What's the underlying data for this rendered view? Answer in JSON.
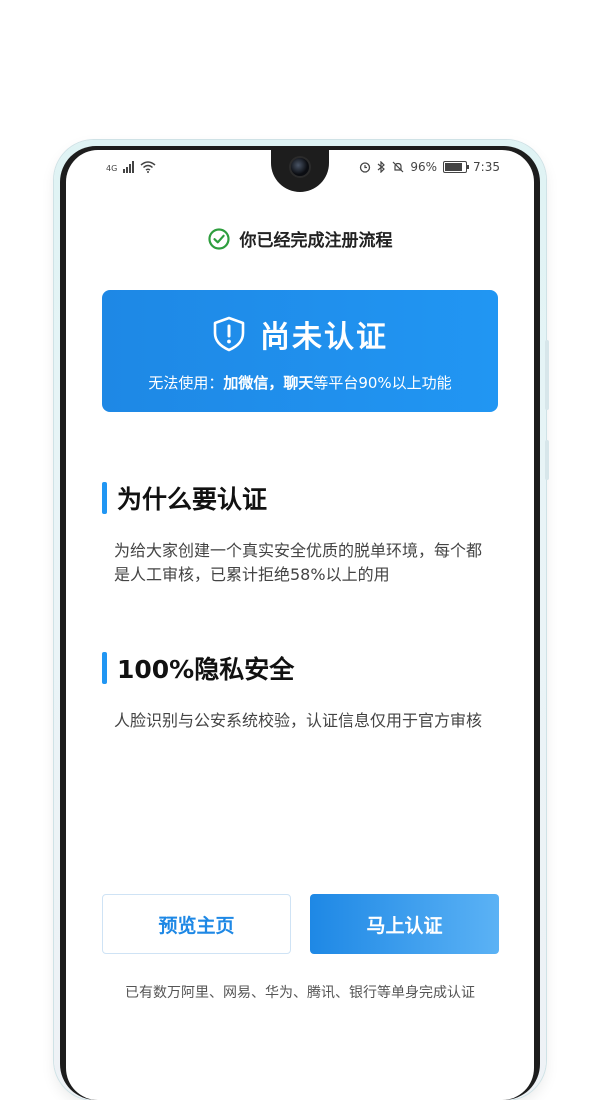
{
  "status_bar": {
    "network": "4G",
    "battery": "96%",
    "battery_level": 0.96,
    "time": "7:35"
  },
  "header": {
    "completed_text": "你已经完成注册流程"
  },
  "card": {
    "title": "尚未认证",
    "desc_prefix": "无法使用：",
    "desc_bold": "加微信，聊天",
    "desc_suffix": "等平台90%以上功能"
  },
  "sections": [
    {
      "title": "为什么要认证",
      "text": "为给大家创建一个真实安全优质的脱单环境，每个都是人工审核，已累计拒绝58%以上的用"
    },
    {
      "title": "100%隐私安全",
      "text": "人脸识别与公安系统校验，认证信息仅用于官方审核"
    }
  ],
  "buttons": {
    "preview_label": "预览主页",
    "verify_label": "马上认证"
  },
  "footer": {
    "note": "已有数万阿里、网易、华为、腾讯、银行等单身完成认证"
  },
  "colors": {
    "accent": "#2196f3",
    "success": "#2e9e3e"
  }
}
